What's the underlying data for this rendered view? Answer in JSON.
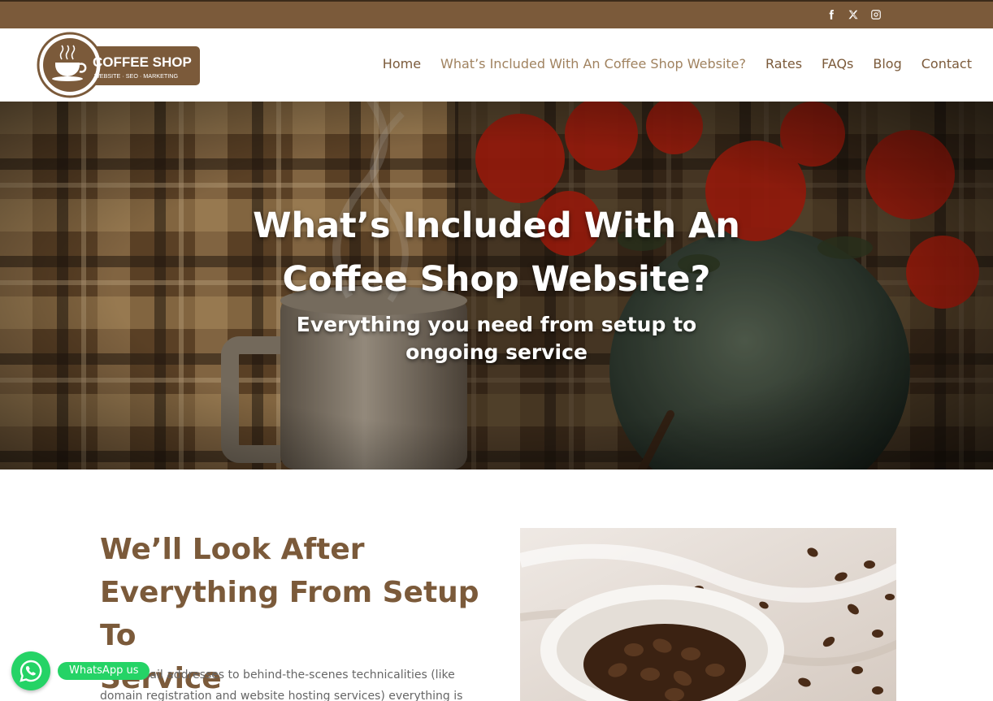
{
  "social": {
    "icons": [
      "facebook-icon",
      "x-icon",
      "instagram-icon"
    ]
  },
  "logo": {
    "name": "COFFEE SHOP",
    "tagline": "WEBSITE · SEO · MARKETING"
  },
  "nav": {
    "items": [
      {
        "label": "Home"
      },
      {
        "label": "What’s Included With An Coffee Shop Website?"
      },
      {
        "label": "Rates"
      },
      {
        "label": "FAQs"
      },
      {
        "label": "Blog"
      },
      {
        "label": "Contact"
      }
    ]
  },
  "hero": {
    "title_line1": "What’s Included With An",
    "title_line2": "Coffee Shop Website?",
    "subtitle_line1": "Everything you need from setup to",
    "subtitle_line2": "ongoing service"
  },
  "content": {
    "title_line1": "We’ll Look After",
    "title_line2": "Everything From Setup To",
    "title_line3": "Service",
    "body_line1": "From email addresses to behind-the-scenes technicalities (like",
    "body_line2": "domain registration and website hosting services) everything is"
  },
  "whatsapp": {
    "label": "WhatsApp us"
  },
  "colors": {
    "brand_brown": "#7b5a3a",
    "whatsapp_green": "#25d366"
  }
}
